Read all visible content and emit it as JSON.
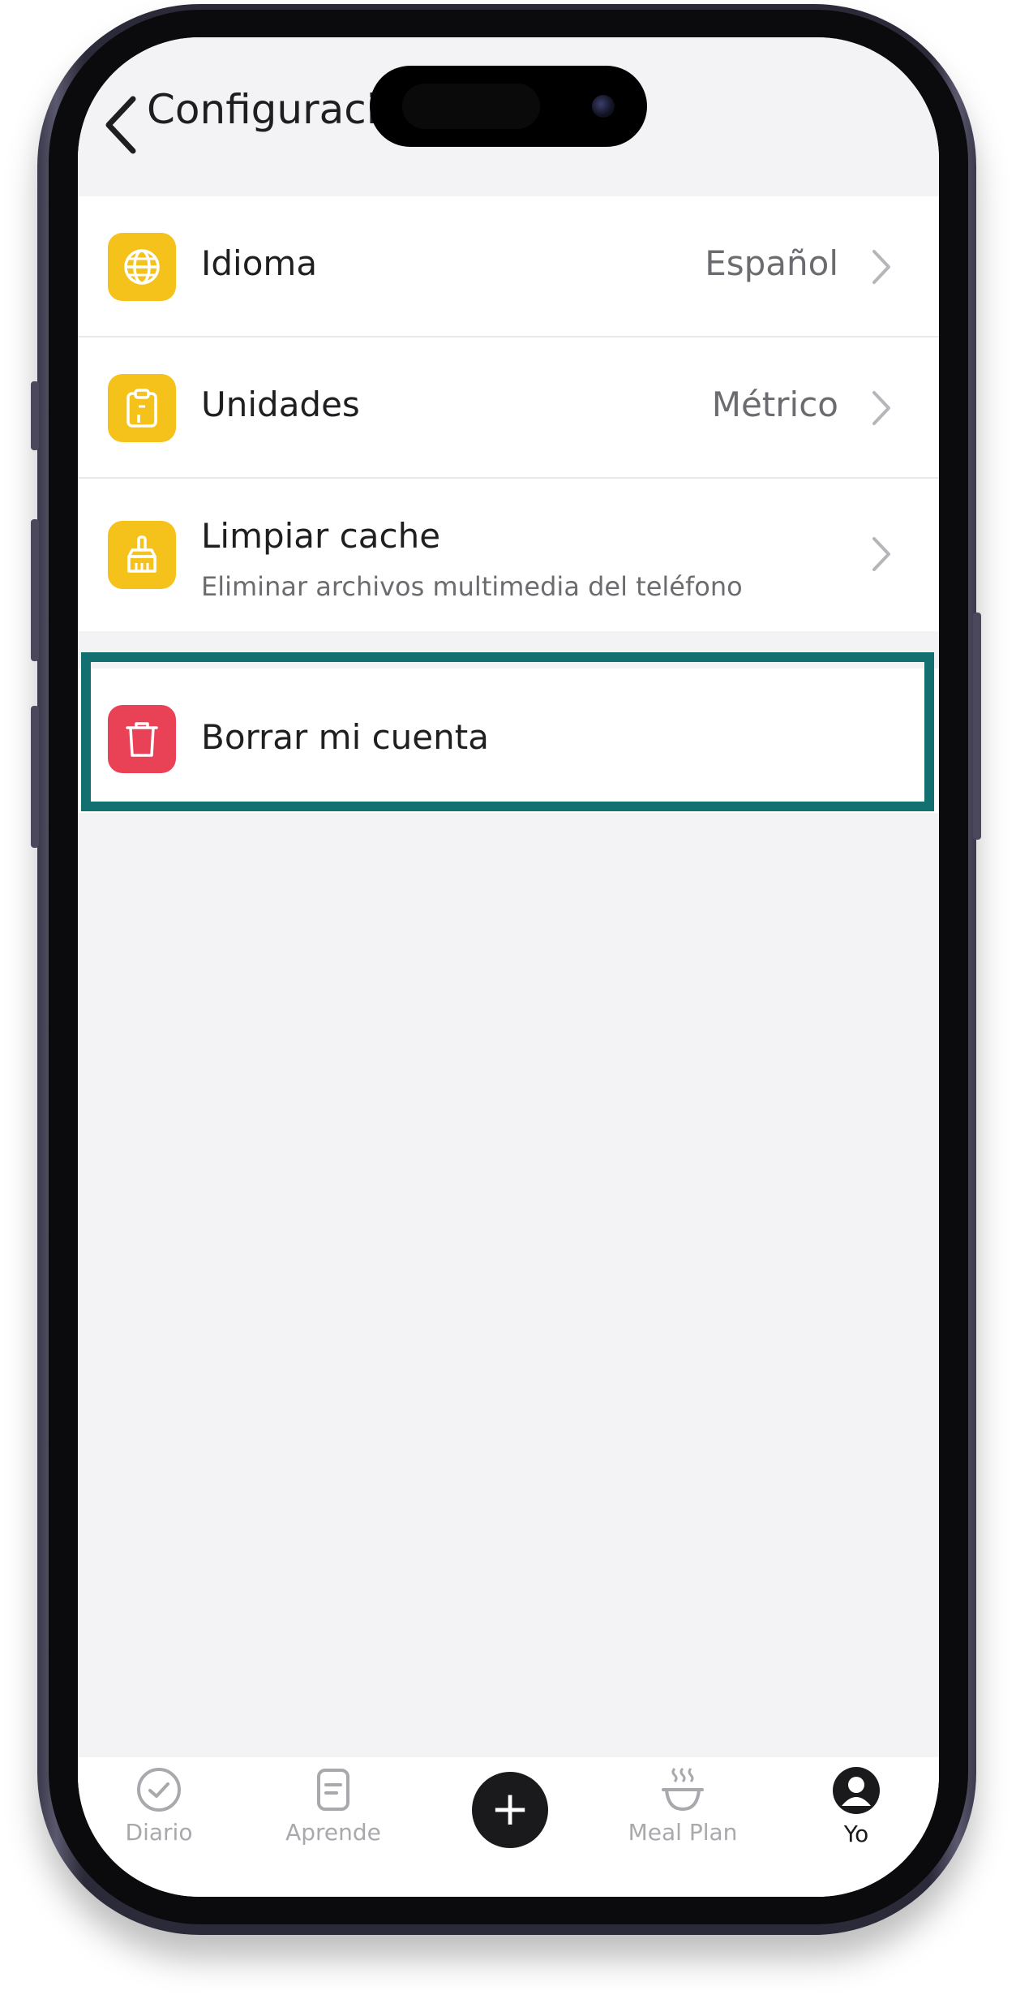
{
  "header": {
    "title": "Configuració"
  },
  "settings": [
    {
      "label": "Idioma",
      "value": "Español",
      "icon": "globe-icon"
    },
    {
      "label": "Unidades",
      "value": "Métrico",
      "icon": "clipboard-icon"
    },
    {
      "label": "Limpiar cache",
      "subtitle": "Eliminar archivos multimedia del teléfono",
      "icon": "broom-icon"
    }
  ],
  "delete_account": {
    "label": "Borrar mi cuenta",
    "icon": "trash-icon"
  },
  "tabbar": {
    "tabs": [
      {
        "label": "Diario",
        "icon": "check-circle-icon"
      },
      {
        "label": "Aprende",
        "icon": "document-icon"
      },
      {
        "label": "+",
        "icon": "plus-icon"
      },
      {
        "label": "Meal Plan",
        "icon": "bowl-icon"
      },
      {
        "label": "Yo",
        "icon": "user-icon",
        "active": true
      }
    ]
  },
  "colors": {
    "accent_yellow": "#f4c21a",
    "danger_red": "#e94257",
    "highlight_teal": "#127070",
    "background": "#f3f2f4"
  }
}
